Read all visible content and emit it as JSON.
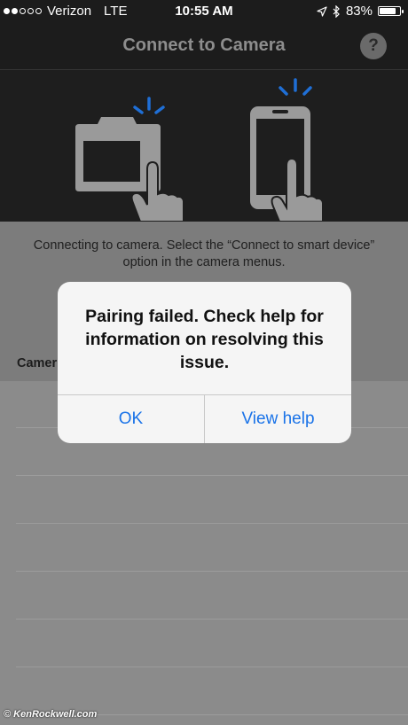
{
  "statusbar": {
    "carrier": "Verizon",
    "network": "LTE",
    "time": "10:55 AM",
    "battery": "83%",
    "battery_level": 0.83,
    "signal_bars_filled": 2,
    "signal_bars_total": 5
  },
  "navbar": {
    "title": "Connect to Camera",
    "help_label": "?"
  },
  "instructions": {
    "text": "Connecting to camera. Select the “Connect to smart device” option in the camera menus."
  },
  "list": {
    "section_label": "Camer"
  },
  "dialog": {
    "message": "Pairing failed. Check help for information on resolving this issue.",
    "ok_label": "OK",
    "view_help_label": "View help"
  },
  "watermark": "© KenRockwell.com",
  "colors": {
    "accent": "#1a73e8",
    "signal_blue": "#1f6fd6",
    "illustration_gray": "#9a9a9a"
  }
}
